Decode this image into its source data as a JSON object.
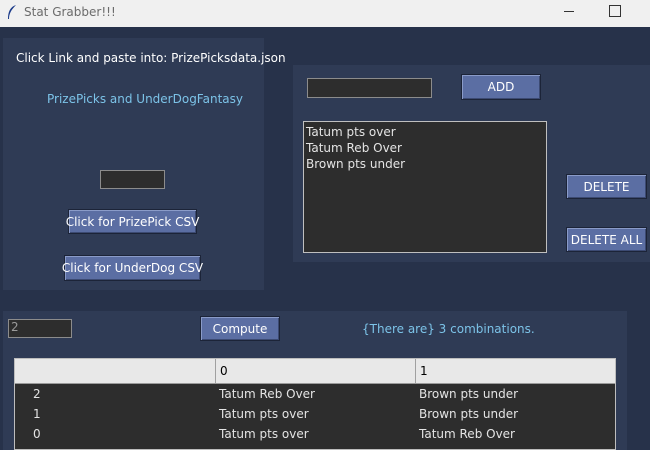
{
  "window": {
    "title": "Stat Grabber!!!",
    "icon": "feather-icon"
  },
  "left_panel": {
    "instruction": "Click Link and paste into: PrizePicksdata.json",
    "sites_link": "PrizePicks and UnderDogFantasy",
    "entry_value": "",
    "prizepick_button": "Click for PrizePick CSV",
    "underdog_button": "Click for UnderDog CSV"
  },
  "right_panel": {
    "add_entry_value": "",
    "add_button": "ADD",
    "list_items": [
      "Tatum pts over",
      "Tatum Reb Over",
      "Brown pts under"
    ],
    "delete_button": "DELETE",
    "delete_all_button": "DELETE ALL"
  },
  "bottom_panel": {
    "size_value": "2",
    "compute_button": "Compute",
    "combinations_text": "{There are} 3 combinations.",
    "table": {
      "columns": [
        "",
        "0",
        "1"
      ],
      "rows": [
        [
          "2",
          "Tatum Reb Over",
          "Brown pts under"
        ],
        [
          "1",
          "Tatum pts over",
          "Brown pts under"
        ],
        [
          "0",
          "Tatum pts over",
          "Tatum Reb Over"
        ]
      ]
    }
  },
  "colors": {
    "background": "#27324a",
    "panel": "#2f3b55",
    "button": "#5b6ea3",
    "link_text": "#7cc3e8"
  }
}
